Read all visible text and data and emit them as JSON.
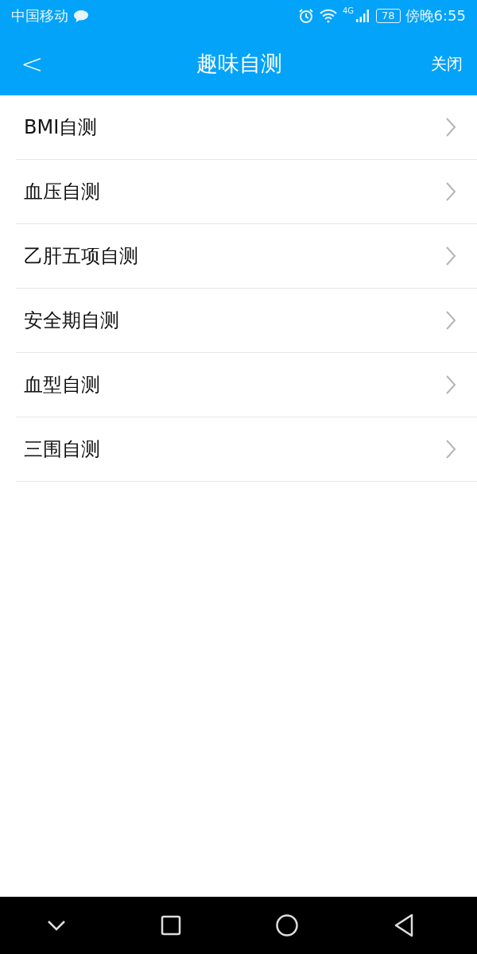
{
  "status_bar": {
    "carrier": "中国移动",
    "network": "4G",
    "battery": "78",
    "time": "傍晚6:55"
  },
  "header": {
    "back": "<",
    "title": "趣味自测",
    "close": "关闭"
  },
  "items": [
    {
      "label": "BMI自测"
    },
    {
      "label": "血压自测"
    },
    {
      "label": "乙肝五项自测"
    },
    {
      "label": "安全期自测"
    },
    {
      "label": "血型自测"
    },
    {
      "label": "三围自测"
    }
  ]
}
